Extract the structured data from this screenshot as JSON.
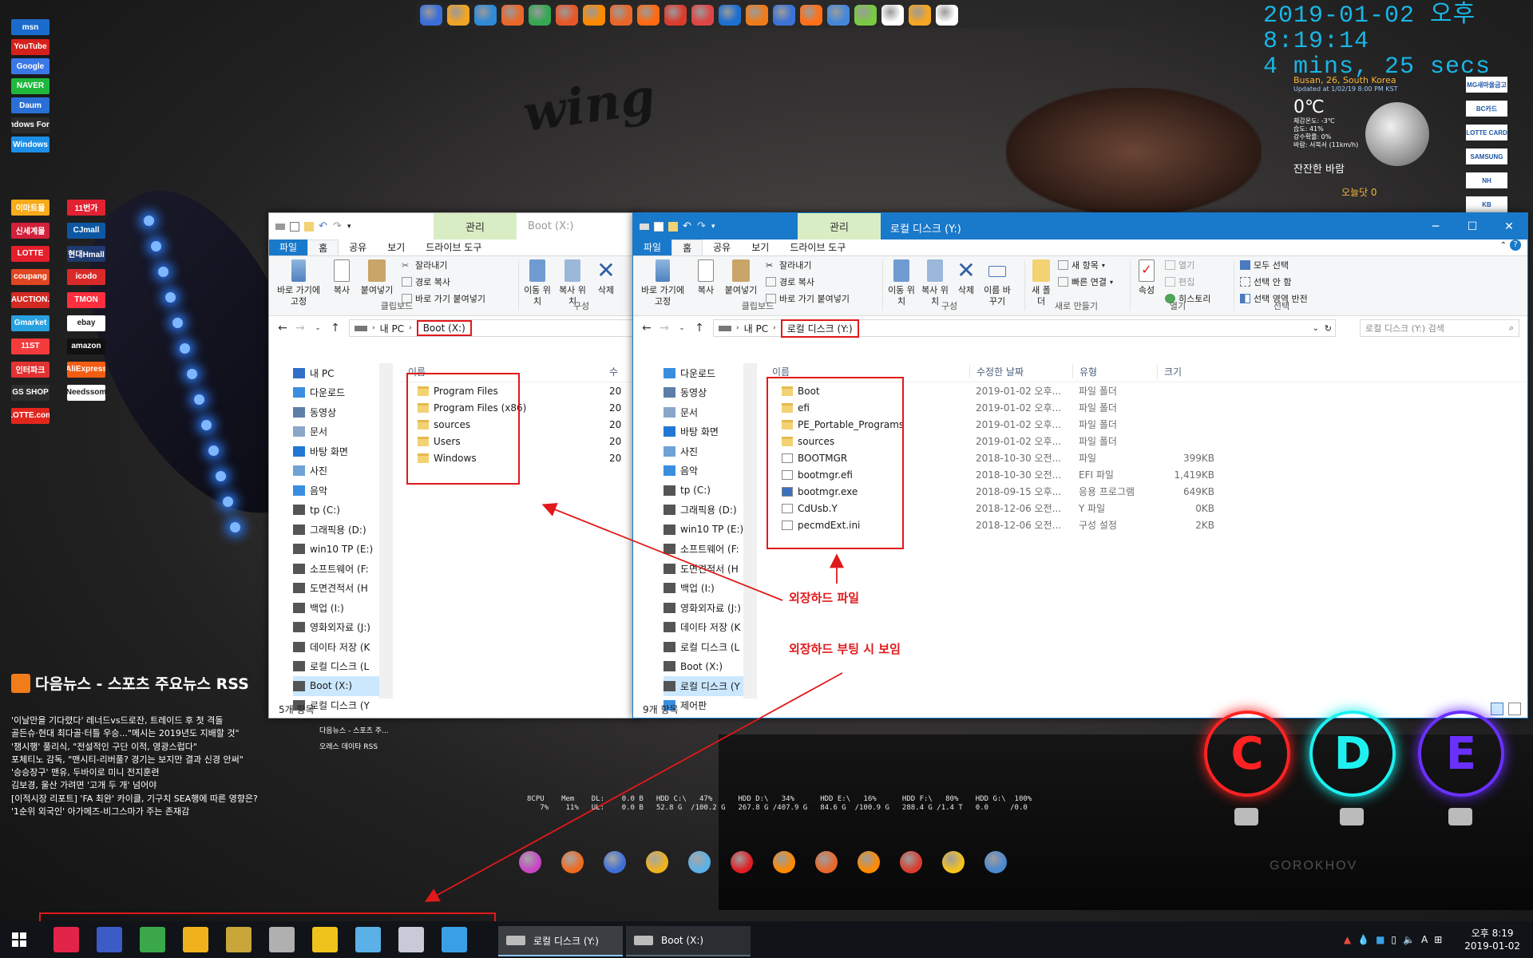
{
  "desktop": {
    "clock_datetime": "2019-01-02 오후 8:19:14",
    "clock_uptime": "4 mins, 25 secs",
    "weather": {
      "location": "Busan, 26, South Korea",
      "updated": "Updated at 1/02/19 8:00 PM KST",
      "temperature": "0℃",
      "feels_like": "체감온도: -3℃",
      "humidity": "습도: 41%",
      "precip": "강수확률: 0%",
      "wind": "바람: 서북서 (11km/h)",
      "description": "잔잔한 바람",
      "today_label": "오늘닷 0"
    },
    "graffiti": "wing",
    "gorokhov": "GOROKHOV"
  },
  "left_shortcuts": [
    {
      "label": "msn",
      "color": "#1b6bcd"
    },
    {
      "label": "YouTube",
      "color": "#d6201c"
    },
    {
      "label": "Google",
      "color": "#3a78e8"
    },
    {
      "label": "NAVER",
      "color": "#1fb83b"
    },
    {
      "label": "Daum",
      "color": "#2a6fd6"
    },
    {
      "label": "Windows Forum",
      "color": "#2b2b2b"
    },
    {
      "label": "Windows",
      "color": "#1d8ee6"
    },
    {
      "label": "이마트몰",
      "color": "#f7ab18"
    },
    {
      "label": "11번가",
      "color": "#e22133"
    },
    {
      "label": "신세계몰",
      "color": "#d3203b"
    },
    {
      "label": "CJmall",
      "color": "#0d57a3"
    },
    {
      "label": "LOTTE",
      "color": "#e41f2b"
    },
    {
      "label": "현대Hmall",
      "color": "#1f3a6e"
    },
    {
      "label": "coupang",
      "color": "#e04521"
    },
    {
      "label": "icodo",
      "color": "#d82a2a"
    },
    {
      "label": "AUCTION.",
      "color": "#d22a22"
    },
    {
      "label": "TMON",
      "color": "#ff2f3f"
    },
    {
      "label": "Gmarket",
      "color": "#27a0e0"
    },
    {
      "label": "ebay",
      "color": "#ffffff"
    },
    {
      "label": "11ST",
      "color": "#f43b3b"
    },
    {
      "label": "amazon",
      "color": "#111111"
    },
    {
      "label": "인터파크",
      "color": "#e23232"
    },
    {
      "label": "AliExpress",
      "color": "#f25d14"
    },
    {
      "label": "GS SHOP",
      "color": "#2d2d2d"
    },
    {
      "label": "Needssom",
      "color": "#ffffff"
    },
    {
      "label": "LOTTE.com",
      "color": "#e2261d"
    }
  ],
  "right_shortcuts": [
    "MG새마을금고",
    "BC카드",
    "LOTTE CARD",
    "SAMSUNG",
    "NH",
    "KB"
  ],
  "top_dock": [
    "#3a6ed8",
    "#f0a526",
    "#2f8ad8",
    "#e9672a",
    "#34a853",
    "#e8572a",
    "#ff8a00",
    "#e9672a",
    "#ff6a13",
    "#d93d2e",
    "#de4646",
    "#1d6fd0",
    "#f07b1a",
    "#3c73d6",
    "#ff7018",
    "#4488d9",
    "#7ac943",
    "#ffffff",
    "#f5a623",
    "#ffffff"
  ],
  "left_window": {
    "context_tab": "관리",
    "title": "Boot (X:)",
    "tabs": {
      "file": "파일",
      "home": "홈",
      "share": "공유",
      "view": "보기",
      "drive": "드라이브 도구"
    },
    "ribbon": {
      "pin": "바로 가기에 고정",
      "copy": "복사",
      "paste": "붙여넣기",
      "cut": "잘라내기",
      "copy_path": "경로 복사",
      "paste_shortcut": "바로 가기 붙여넣기",
      "move_to": "이동 위치",
      "copy_to": "복사 위치",
      "delete": "삭제",
      "group_clipboard": "클립보드",
      "group_organize": "구성"
    },
    "address": {
      "root": "내 PC",
      "current": "Boot (X:)"
    },
    "nav": [
      "내 PC",
      "다운로드",
      "동영상",
      "문서",
      "바탕 화면",
      "사진",
      "음악",
      "tp (C:)",
      "그래픽용 (D:)",
      "win10 TP (E:)",
      "소프트웨어 (F:",
      "도면견적서 (H",
      "백업 (I:)",
      "영화외자료 (J:)",
      "데이타 저장 (K",
      "로컬 디스크 (L",
      "Boot (X:)",
      "로컬 디스크 (Y"
    ],
    "columns": {
      "name": "이름",
      "modified": "수"
    },
    "files": [
      {
        "name": "Program Files",
        "date": "20"
      },
      {
        "name": "Program Files (x86)",
        "date": "20"
      },
      {
        "name": "sources",
        "date": "20"
      },
      {
        "name": "Users",
        "date": "20"
      },
      {
        "name": "Windows",
        "date": "20"
      }
    ],
    "status": "5개 항목"
  },
  "right_window": {
    "context_tab": "관리",
    "title": "로컬 디스크 (Y:)",
    "tabs": {
      "file": "파일",
      "home": "홈",
      "share": "공유",
      "view": "보기",
      "drive": "드라이브 도구"
    },
    "ribbon": {
      "pin": "바로 가기에 고정",
      "copy": "복사",
      "paste": "붙여넣기",
      "cut": "잘라내기",
      "copy_path": "경로 복사",
      "paste_shortcut": "바로 가기 붙여넣기",
      "move_to": "이동 위치",
      "copy_to": "복사 위치",
      "delete": "삭제",
      "rename": "이름 바꾸기",
      "new_folder": "새 폴더",
      "new_item": "새 항목",
      "easy_access": "빠른 연결",
      "properties": "속성",
      "open": "열기",
      "edit": "편집",
      "history": "히스토리",
      "select_all": "모두 선택",
      "select_none": "선택 안 함",
      "invert": "선택 영역 반전",
      "group_clipboard": "클립보드",
      "group_organize": "구성",
      "group_new": "새로 만들기",
      "group_open": "열기",
      "group_select": "선택"
    },
    "address": {
      "root": "내 PC",
      "current": "로컬 디스크 (Y:)"
    },
    "search_placeholder": "로컬 디스크 (Y:) 검색",
    "nav": [
      "다운로드",
      "동영상",
      "문서",
      "바탕 화면",
      "사진",
      "음악",
      "tp (C:)",
      "그래픽용 (D:)",
      "win10 TP (E:)",
      "소프트웨어 (F:",
      "도면견적서 (H",
      "백업 (I:)",
      "영화외자료 (J:)",
      "데이타 저장 (K",
      "로컬 디스크 (L",
      "Boot (X:)",
      "로컬 디스크 (Y",
      "제어판"
    ],
    "columns": {
      "name": "이름",
      "modified": "수정한 날짜",
      "type": "유형",
      "size": "크기"
    },
    "files": [
      {
        "name": "Boot",
        "date": "2019-01-02 오후...",
        "type": "파일 폴더",
        "size": "",
        "kind": "folder"
      },
      {
        "name": "efi",
        "date": "2019-01-02 오후...",
        "type": "파일 폴더",
        "size": "",
        "kind": "folder"
      },
      {
        "name": "PE_Portable_Programs",
        "date": "2019-01-02 오후...",
        "type": "파일 폴더",
        "size": "",
        "kind": "folder"
      },
      {
        "name": "sources",
        "date": "2019-01-02 오후...",
        "type": "파일 폴더",
        "size": "",
        "kind": "folder"
      },
      {
        "name": "BOOTMGR",
        "date": "2018-10-30 오전...",
        "type": "파일",
        "size": "399KB",
        "kind": "file"
      },
      {
        "name": "bootmgr.efi",
        "date": "2018-10-30 오전...",
        "type": "EFI 파일",
        "size": "1,419KB",
        "kind": "file"
      },
      {
        "name": "bootmgr.exe",
        "date": "2018-09-15 오후...",
        "type": "응용 프로그램",
        "size": "649KB",
        "kind": "exe"
      },
      {
        "name": "CdUsb.Y",
        "date": "2018-12-06 오전...",
        "type": "Y 파일",
        "size": "0KB",
        "kind": "file"
      },
      {
        "name": "pecmdExt.ini",
        "date": "2018-12-06 오전...",
        "type": "구성 설정",
        "size": "2KB",
        "kind": "file"
      }
    ],
    "status": "9개 항목"
  },
  "annotations": {
    "external_files": "외장하드 파일",
    "external_boot_visible": "외장하드 부팅 시 보임"
  },
  "rss": {
    "title": "다음뉴스 - 스포츠 주요뉴스 RSS",
    "items": [
      "'이날만을 기다렸다' 레너드vs드로잔, 트레이드 후 첫 격돌",
      "골든슈·현대 최다골·터틀 우승...\"메시는 2019년도 지배할 것\"",
      "'챔시행' 풀리식, \"전설적인 구단 이적, 영광스럽다\"",
      "포체티노 감독, \"맨시티-리버풀? 경기는 보지만 결과 신경 안써\"",
      "'승승장구' 맨유, 두바이로 미니 전지훈련",
      "김보경, 울산 가려면 '고개 두 개' 넘어야",
      "[이적시장 리포트] 'FA 최완' 카이클, 기구치 SEA행에 따른 영향은?",
      "'1순위 외국인' 아가메즈-비그스마가 주는 존재감"
    ],
    "side_items": [
      "다음뉴스 - 스포츠 주...",
      "오레스 데이타 RSS"
    ]
  },
  "sysmon": [
    "8CPU\n   7%",
    "Mem\n 11%",
    "DL:    0.0 B\nUL:    0.0 B",
    "HDD C:\\   47%\n52.8 G  /100.2 G",
    "HDD D:\\   34%\n267.8 G /407.9 G",
    "HDD E:\\   16%\n84.6 G  /100.9 G",
    "HDD F:\\   80%\n288.4 G /1.4 T",
    "HDD G:\\  100%\n0.0     /0.0"
  ],
  "drive_rings": [
    {
      "letter": "C",
      "color": "#ff2222"
    },
    {
      "letter": "D",
      "color": "#1ef0f0"
    },
    {
      "letter": "E",
      "color": "#6a30ff"
    }
  ],
  "bottom_dock": [
    "#c944c5",
    "#f06b1c",
    "#3d6ed8",
    "#f0b21c",
    "#5bb0e8",
    "#e21c24",
    "#ff8a00",
    "#e9672a",
    "#ff8a00",
    "#d93d2e",
    "#f5c31c",
    "#4a88d0"
  ],
  "taskbar": {
    "pinned": [
      "#e2244a",
      "#3b5bc6",
      "#3aa84a",
      "#f0b21c",
      "#c8a63a",
      "#b0b0b0",
      "#f0c21c",
      "#5bb0e8",
      "#c9c9d8",
      "#3aa0e6"
    ],
    "tasks": [
      "로컬 디스크 (Y:)",
      "Boot (X:)"
    ],
    "time": "오후 8:19",
    "date": "2019-01-02",
    "ime": "A"
  }
}
